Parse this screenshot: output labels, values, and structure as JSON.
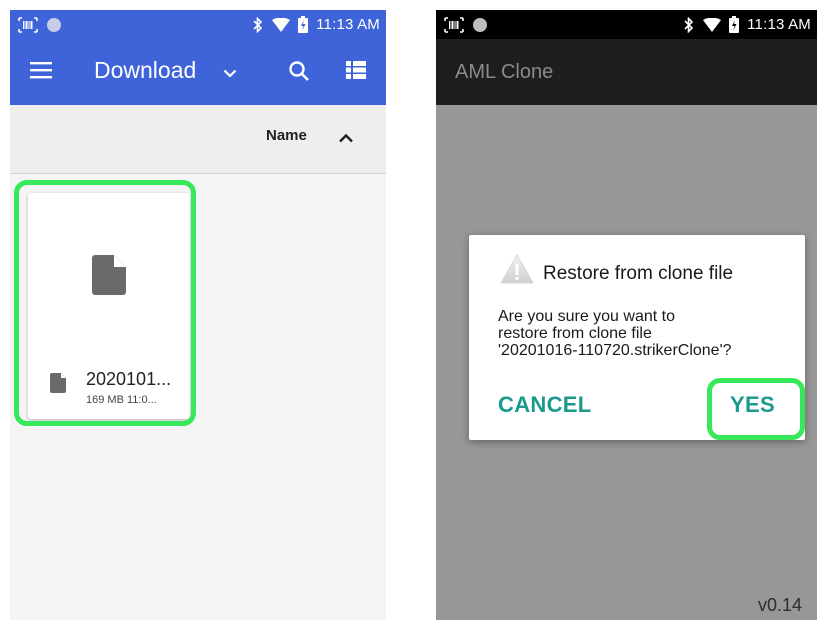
{
  "left_screen": {
    "status_bar": {
      "time": "11:13 AM"
    },
    "app_bar": {
      "title": "Download"
    },
    "sort_bar": {
      "label": "Name"
    },
    "file": {
      "name": "2020101...",
      "meta": "169 MB 11:0..."
    }
  },
  "right_screen": {
    "status_bar": {
      "time": "11:13 AM"
    },
    "app_bar": {
      "title": "AML Clone"
    },
    "dialog": {
      "title": "Restore from clone file",
      "message_lines": [
        "Are you sure you want to",
        "restore from clone file",
        "'20201016-110720.strikerClone'?"
      ],
      "cancel_label": "CANCEL",
      "confirm_label": "YES"
    },
    "version": "v0.14"
  },
  "colors": {
    "primary": "#3f63d9",
    "accent": "#1a9a8c",
    "highlight": "#37e85b",
    "dark_bar": "#1e1e1e"
  },
  "icons": {
    "left_menu": "hamburger-menu-icon",
    "left_dropdown": "chevron-down-icon",
    "left_search": "search-icon",
    "left_view": "list-view-icon",
    "sort": "chevron-up-icon",
    "file": "file-icon",
    "dialog": "warning-icon"
  }
}
